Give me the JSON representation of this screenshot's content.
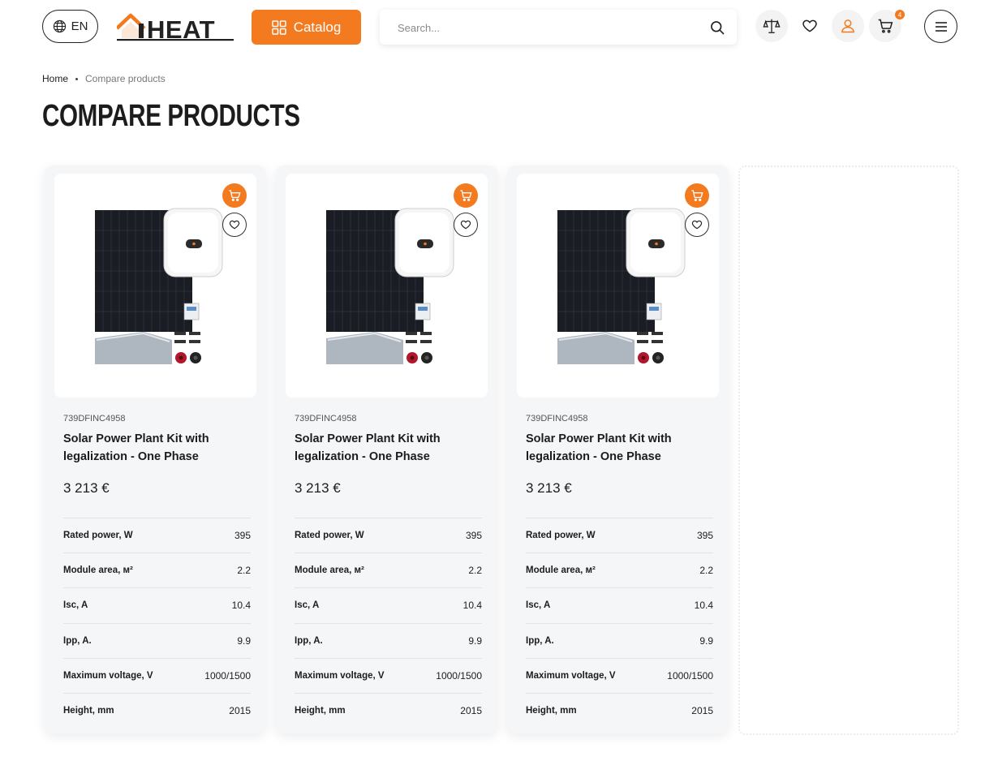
{
  "header": {
    "lang_label": "EN",
    "logo_text": "IHEAT",
    "catalog_label": "Catalog",
    "search_placeholder": "Search...",
    "cart_count": "4"
  },
  "breadcrumb": {
    "home": "Home",
    "current": "Compare products"
  },
  "page_title": "COMPARE PRODUCTS",
  "products": [
    {
      "sku": "739DFINC4958",
      "name": "Solar Power Plant Kit with legalization - One Phase",
      "price": "3 213 €",
      "specs": [
        {
          "label": "Rated power, W",
          "value": "395"
        },
        {
          "label": "Module area, м²",
          "value": "2.2"
        },
        {
          "label": "Isc, A",
          "value": "10.4"
        },
        {
          "label": "Ipp, A.",
          "value": "9.9"
        },
        {
          "label": "Maximum voltage, V",
          "value": "1000/1500"
        },
        {
          "label": "Height, mm",
          "value": "2015"
        }
      ]
    },
    {
      "sku": "739DFINC4958",
      "name": "Solar Power Plant Kit with legalization - One Phase",
      "price": "3 213 €",
      "specs": [
        {
          "label": "Rated power, W",
          "value": "395"
        },
        {
          "label": "Module area, м²",
          "value": "2.2"
        },
        {
          "label": "Isc, A",
          "value": "10.4"
        },
        {
          "label": "Ipp, A.",
          "value": "9.9"
        },
        {
          "label": "Maximum voltage, V",
          "value": "1000/1500"
        },
        {
          "label": "Height, mm",
          "value": "2015"
        }
      ]
    },
    {
      "sku": "739DFINC4958",
      "name": "Solar Power Plant Kit with legalization - One Phase",
      "price": "3 213 €",
      "specs": [
        {
          "label": "Rated power, W",
          "value": "395"
        },
        {
          "label": "Module area, м²",
          "value": "2.2"
        },
        {
          "label": "Isc, A",
          "value": "10.4"
        },
        {
          "label": "Ipp, A.",
          "value": "9.9"
        },
        {
          "label": "Maximum voltage, V",
          "value": "1000/1500"
        },
        {
          "label": "Height, mm",
          "value": "2015"
        }
      ]
    }
  ],
  "colors": {
    "accent": "#f47a20",
    "card_bg": "#f5f6f8",
    "text": "#1c1c1c"
  }
}
